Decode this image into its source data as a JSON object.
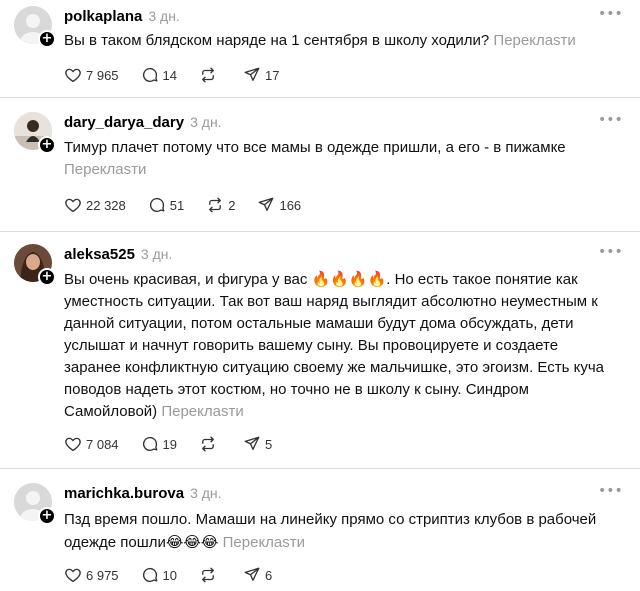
{
  "translate_label": "Переклasти",
  "comments": [
    {
      "username": "polkaplana",
      "time": "3 дн.",
      "text": "Вы в таком блядском наряде на 1 сентября в школу ходили?",
      "likes": "7 965",
      "replies": "14",
      "reposts": "",
      "shares": "17",
      "avatar": "default"
    },
    {
      "username": "dary_darya_dary",
      "time": "3 дн.",
      "text": "Тимур плачет потому что все мамы в одежде пришли, а его - в пижамке",
      "likes": "22 328",
      "replies": "51",
      "reposts": "2",
      "shares": "166",
      "avatar": "photo"
    },
    {
      "username": "aleksa525",
      "time": "3 дн.",
      "text_part1": "Вы очень красивая, и фигура у вас ",
      "fire_emojis": "🔥🔥🔥🔥",
      "text_part2": ". Но есть такое понятие как уместность ситуации. Так вот ваш наряд выглядит абсолютно неуместным к данной ситуации, потом остальные мамаши будут дома обсуждать, дети услышат и начнут говорить вашему сыну. Вы провоцируете и создаете заранее конфликтную ситуацию своему же мальчишке, это эгоизм. Есть куча поводов надеть этот костюм, но точно не в школу к сыну. Синдром Самойловой)",
      "likes": "7 084",
      "replies": "19",
      "reposts": "",
      "shares": "5",
      "avatar": "photo"
    },
    {
      "username": "marichka.burova",
      "time": "3 дн.",
      "text": "Пзд время пошло. Мамаши на линейку прямо со стриптиз клубов в рабочей одежде пошли",
      "laugh_emojis": "😂😂😂",
      "likes": "6 975",
      "replies": "10",
      "reposts": "",
      "shares": "6",
      "avatar": "default"
    }
  ],
  "icons": {
    "like": "heart-icon",
    "reply": "speech-bubble-icon",
    "repost": "repost-arrows-icon",
    "share": "paper-plane-icon",
    "more": "ellipsis-icon",
    "follow": "plus-icon"
  },
  "colors": {
    "muted": "#9a9a9a",
    "text": "#111111",
    "divider": "#dcdcdc",
    "badge": "#000000"
  }
}
